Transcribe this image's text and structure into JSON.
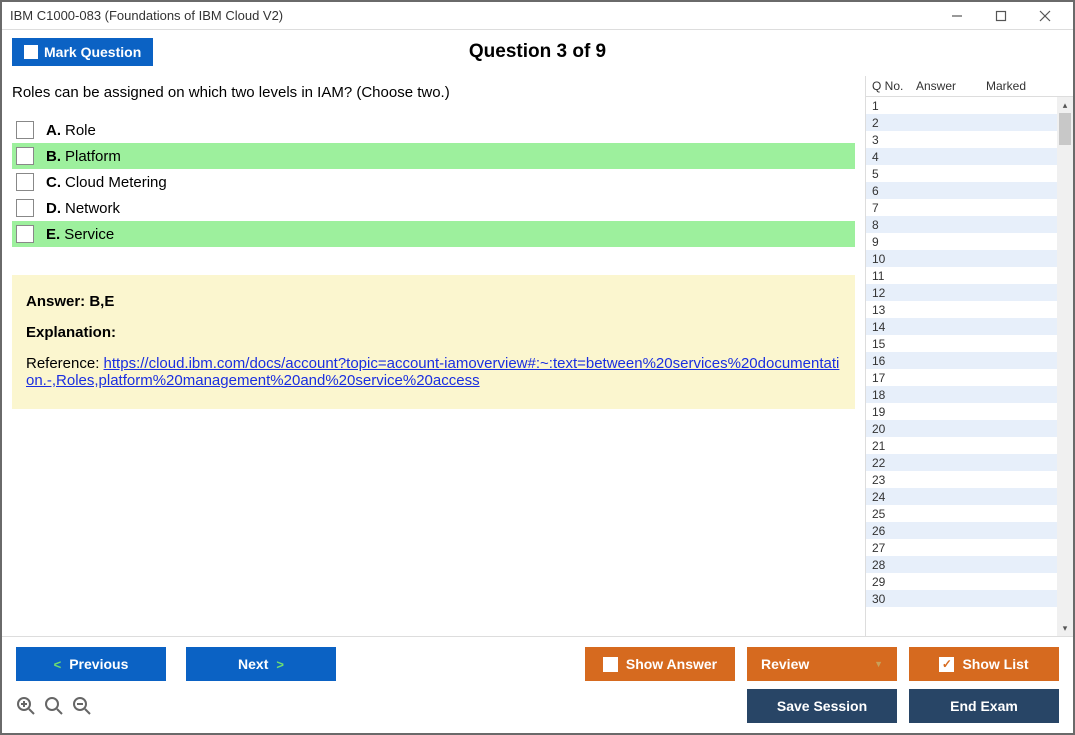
{
  "window": {
    "title": "IBM C1000-083 (Foundations of IBM Cloud V2)"
  },
  "header": {
    "mark_label": "Mark Question",
    "counter": "Question 3 of 9"
  },
  "question": {
    "text": "Roles can be assigned on which two levels in IAM? (Choose two.)",
    "options": [
      {
        "letter": "A.",
        "text": "Role",
        "correct": false
      },
      {
        "letter": "B.",
        "text": "Platform",
        "correct": true
      },
      {
        "letter": "C.",
        "text": "Cloud Metering",
        "correct": false
      },
      {
        "letter": "D.",
        "text": "Network",
        "correct": false
      },
      {
        "letter": "E.",
        "text": "Service",
        "correct": true
      }
    ]
  },
  "answer": {
    "label": "Answer: B,E",
    "explanation_label": "Explanation:",
    "reference_prefix": "Reference: ",
    "reference_link": "https://cloud.ibm.com/docs/account?topic=account-iamoverview#:~:text=between%20services%20documentation.-,Roles,platform%20management%20and%20service%20access"
  },
  "sidebar": {
    "headers": {
      "qno": "Q No.",
      "answer": "Answer",
      "marked": "Marked"
    },
    "row_count": 30
  },
  "footer": {
    "previous": "Previous",
    "next": "Next",
    "show_answer": "Show Answer",
    "review": "Review",
    "show_list": "Show List",
    "save_session": "Save Session",
    "end_exam": "End Exam"
  }
}
